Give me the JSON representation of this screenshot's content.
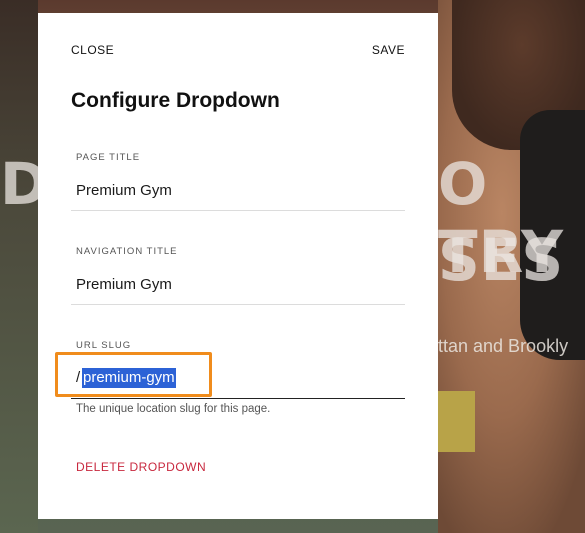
{
  "background": {
    "headline_line1_left": "D",
    "headline_line1_right": "O TRY",
    "headline_line2_right": "SES",
    "subline": "ttan and Brookly",
    "accent_color": "#b8a348"
  },
  "modal": {
    "close_label": "CLOSE",
    "save_label": "SAVE",
    "title": "Configure Dropdown",
    "fields": {
      "page_title": {
        "label": "PAGE TITLE",
        "value": "Premium Gym"
      },
      "navigation_title": {
        "label": "NAVIGATION TITLE",
        "value": "Premium Gym"
      },
      "url_slug": {
        "label": "URL SLUG",
        "prefix": "/",
        "value": "premium-gym",
        "helper": "The unique location slug for this page.",
        "selection_color": "#2c62d6",
        "highlight_color": "#f08c1c"
      }
    },
    "delete_label": "DELETE DROPDOWN",
    "delete_color": "#c8283e"
  }
}
